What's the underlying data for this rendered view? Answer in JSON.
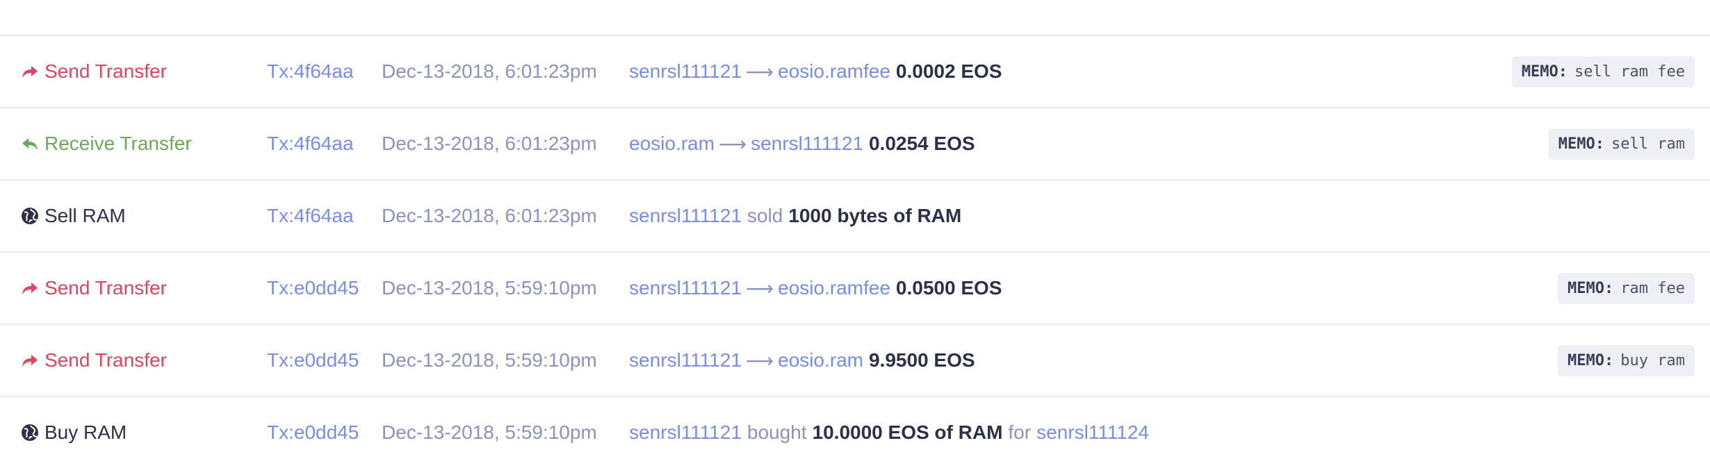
{
  "rows": [
    {
      "kind": "send",
      "action": "Send Transfer",
      "action_icon": "share-arrow-icon",
      "tx": "Tx:4f64aa",
      "time": "Dec-13-2018, 6:01:23pm",
      "from": "senrsl111121",
      "arrow": "⟶",
      "to": "eosio.ramfee",
      "amount": "0.0002 EOS",
      "memo_label": "MEMO:",
      "memo": "sell ram fee"
    },
    {
      "kind": "receive",
      "action": "Receive Transfer",
      "action_icon": "reply-arrow-icon",
      "tx": "Tx:4f64aa",
      "time": "Dec-13-2018, 6:01:23pm",
      "from": "eosio.ram",
      "arrow": "⟶",
      "to": "senrsl111121",
      "amount": "0.0254 EOS",
      "memo_label": "MEMO:",
      "memo": "sell ram"
    },
    {
      "kind": "sellram",
      "action": "Sell RAM",
      "action_icon": "globe-icon",
      "tx": "Tx:4f64aa",
      "time": "Dec-13-2018, 6:01:23pm",
      "account": "senrsl111121",
      "verb": "sold",
      "quantity": "1000 bytes of RAM"
    },
    {
      "kind": "send",
      "action": "Send Transfer",
      "action_icon": "share-arrow-icon",
      "tx": "Tx:e0dd45",
      "time": "Dec-13-2018, 5:59:10pm",
      "from": "senrsl111121",
      "arrow": "⟶",
      "to": "eosio.ramfee",
      "amount": "0.0500 EOS",
      "memo_label": "MEMO:",
      "memo": "ram fee"
    },
    {
      "kind": "send",
      "action": "Send Transfer",
      "action_icon": "share-arrow-icon",
      "tx": "Tx:e0dd45",
      "time": "Dec-13-2018, 5:59:10pm",
      "from": "senrsl111121",
      "arrow": "⟶",
      "to": "eosio.ram",
      "amount": "9.9500 EOS",
      "memo_label": "MEMO:",
      "memo": "buy ram"
    },
    {
      "kind": "buyram",
      "action": "Buy RAM",
      "action_icon": "globe-icon",
      "tx": "Tx:e0dd45",
      "time": "Dec-13-2018, 5:59:10pm",
      "account": "senrsl111121",
      "verb": "bought",
      "quantity": "10.0000 EOS of RAM",
      "for_word": "for",
      "receiver": "senrsl111124"
    }
  ],
  "colors": {
    "send": "#e0455f",
    "receive": "#6aaa5a",
    "link": "#7b8ce6",
    "muted": "#8c93ba",
    "strong": "#2c3147",
    "memo_bg": "#eef0f6"
  }
}
